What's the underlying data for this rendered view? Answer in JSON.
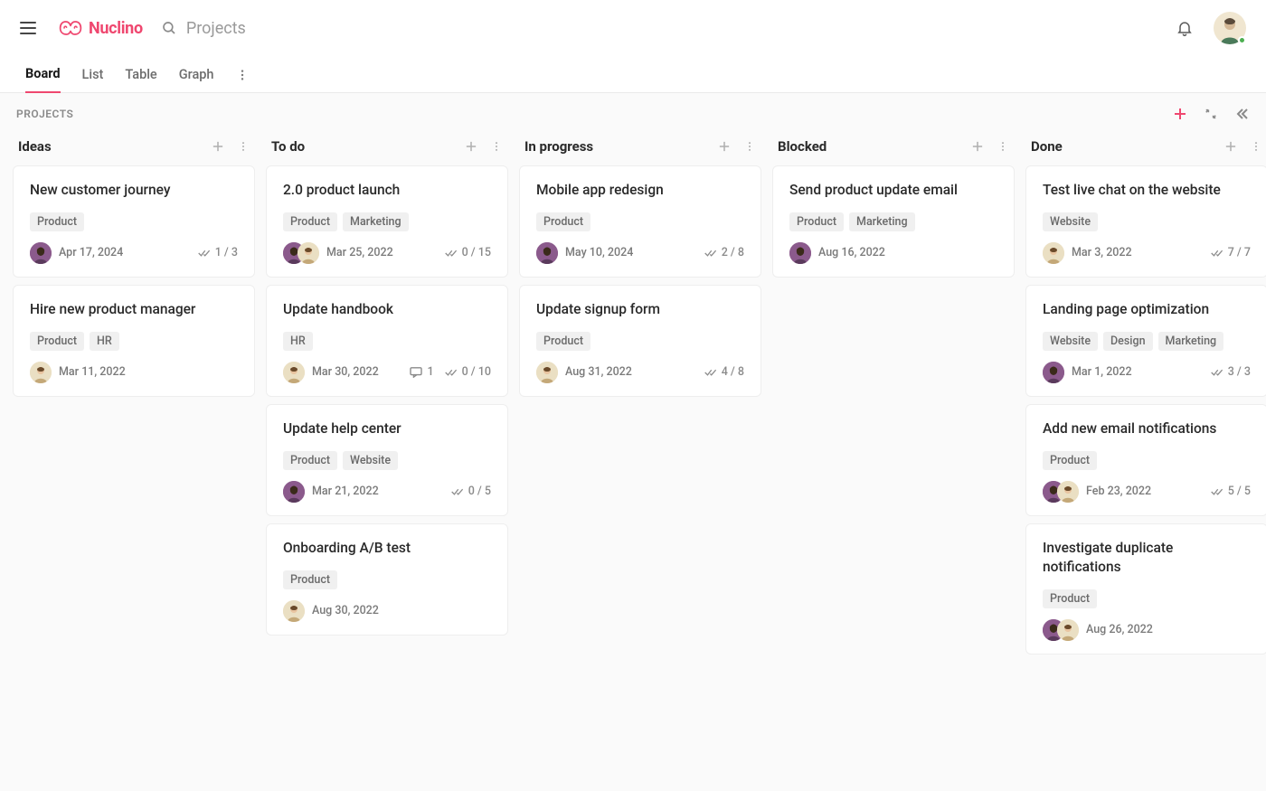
{
  "brand": {
    "name": "Nuclino"
  },
  "search": {
    "placeholder": "Projects"
  },
  "tabs": [
    {
      "label": "Board",
      "active": true
    },
    {
      "label": "List",
      "active": false
    },
    {
      "label": "Table",
      "active": false
    },
    {
      "label": "Graph",
      "active": false
    }
  ],
  "board": {
    "title": "PROJECTS"
  },
  "columns": [
    {
      "title": "Ideas",
      "cards": [
        {
          "title": "New customer journey",
          "tags": [
            "Product"
          ],
          "avatars": [
            "a"
          ],
          "date": "Apr 17, 2024",
          "progress": "1 / 3",
          "comments": null
        },
        {
          "title": "Hire new product manager",
          "tags": [
            "Product",
            "HR"
          ],
          "avatars": [
            "b"
          ],
          "date": "Mar 11, 2022",
          "progress": null,
          "comments": null
        }
      ]
    },
    {
      "title": "To do",
      "cards": [
        {
          "title": "2.0 product launch",
          "tags": [
            "Product",
            "Marketing"
          ],
          "avatars": [
            "a",
            "b"
          ],
          "date": "Mar 25, 2022",
          "progress": "0 / 15",
          "comments": null
        },
        {
          "title": "Update handbook",
          "tags": [
            "HR"
          ],
          "avatars": [
            "b"
          ],
          "date": "Mar 30, 2022",
          "progress": "0 / 10",
          "comments": "1"
        },
        {
          "title": "Update help center",
          "tags": [
            "Product",
            "Website"
          ],
          "avatars": [
            "a"
          ],
          "date": "Mar 21, 2022",
          "progress": "0 / 5",
          "comments": null
        },
        {
          "title": "Onboarding A/B test",
          "tags": [
            "Product"
          ],
          "avatars": [
            "b"
          ],
          "date": "Aug 30, 2022",
          "progress": null,
          "comments": null
        }
      ]
    },
    {
      "title": "In progress",
      "cards": [
        {
          "title": "Mobile app redesign",
          "tags": [
            "Product"
          ],
          "avatars": [
            "a"
          ],
          "date": "May 10, 2024",
          "progress": "2 / 8",
          "comments": null
        },
        {
          "title": "Update signup form",
          "tags": [
            "Product"
          ],
          "avatars": [
            "b"
          ],
          "date": "Aug 31, 2022",
          "progress": "4 / 8",
          "comments": null
        }
      ]
    },
    {
      "title": "Blocked",
      "cards": [
        {
          "title": "Send product update email",
          "tags": [
            "Product",
            "Marketing"
          ],
          "avatars": [
            "a"
          ],
          "date": "Aug 16, 2022",
          "progress": null,
          "comments": null
        }
      ]
    },
    {
      "title": "Done",
      "cards": [
        {
          "title": "Test live chat on the website",
          "tags": [
            "Website"
          ],
          "avatars": [
            "b"
          ],
          "date": "Mar 3, 2022",
          "progress": "7 / 7",
          "comments": null
        },
        {
          "title": "Landing page optimization",
          "tags": [
            "Website",
            "Design",
            "Marketing"
          ],
          "avatars": [
            "a"
          ],
          "date": "Mar 1, 2022",
          "progress": "3 / 3",
          "comments": null
        },
        {
          "title": "Add new email notifications",
          "tags": [
            "Product"
          ],
          "avatars": [
            "a",
            "b"
          ],
          "date": "Feb 23, 2022",
          "progress": "5 / 5",
          "comments": null
        },
        {
          "title": "Investigate duplicate notifications",
          "tags": [
            "Product"
          ],
          "avatars": [
            "a",
            "b"
          ],
          "date": "Aug 26, 2022",
          "progress": null,
          "comments": null
        }
      ]
    }
  ]
}
